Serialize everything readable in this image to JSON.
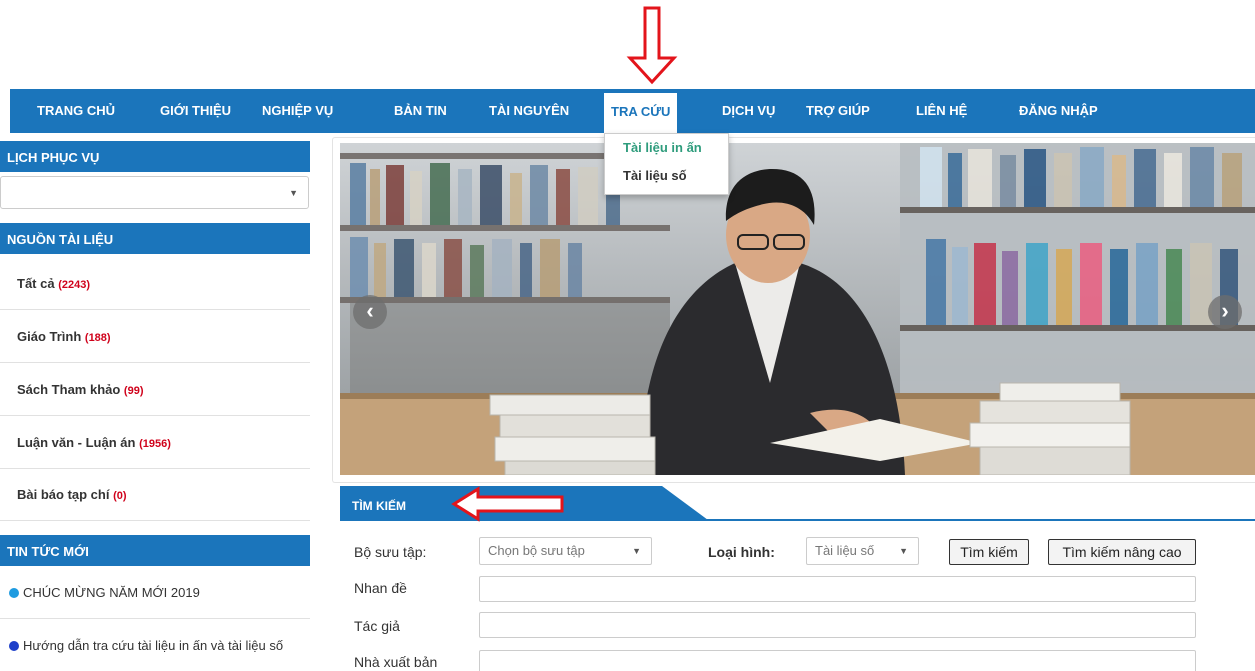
{
  "nav": {
    "items": [
      "TRANG CHỦ",
      "GIỚI THIỆU",
      "NGHIỆP VỤ",
      "BẢN TIN",
      "TÀI NGUYÊN",
      "TRA CỨU",
      "DỊCH VỤ",
      "TRỢ GIÚP",
      "LIÊN HỆ",
      "ĐĂNG NHẬP"
    ],
    "active": "TRA CỨU",
    "dropdown": [
      "Tài liệu in ấn",
      "Tài liệu số"
    ]
  },
  "sidebar": {
    "schedule_title": "LỊCH PHỤC VỤ",
    "schedule_select_value": "",
    "sources_title": "NGUỒN TÀI LIỆU",
    "sources": [
      {
        "label": "Tất cả ",
        "count": "(2243)"
      },
      {
        "label": "Giáo Trình ",
        "count": "(188)"
      },
      {
        "label": "Sách Tham khảo ",
        "count": "(99)"
      },
      {
        "label": "Luận văn - Luận án ",
        "count": "(1956)"
      },
      {
        "label": "Bài báo tạp chí ",
        "count": "(0)"
      }
    ],
    "news_title": "TIN TỨC MỚI",
    "news": [
      {
        "text": "CHÚC MỪNG NĂM MỚI 2019",
        "bullet_color": "#1e9be0"
      },
      {
        "text": "Hướng dẫn tra cứu tài liệu in ấn và tài liệu số",
        "bullet_color": "#1d3fc9"
      }
    ]
  },
  "banner": {
    "prev_icon": "chevron-left-icon",
    "next_icon": "chevron-right-icon"
  },
  "search": {
    "title": "TÌM KIẾM",
    "collection_label": "Bộ sưu tập:",
    "collection_value": "Chọn bộ sưu tập",
    "type_label": "Loại hình:",
    "type_value": "Tài liệu số",
    "search_button": "Tìm kiếm",
    "advanced_button": "Tìm kiếm nâng cao",
    "title_label": "Nhan đề",
    "author_label": "Tác giả",
    "publisher_label": "Nhà xuất bản"
  },
  "colors": {
    "brand": "#1b75bb",
    "count": "#d0021b",
    "annotation": "#e3141b",
    "dropdown_highlight": "#2e9c7c"
  }
}
